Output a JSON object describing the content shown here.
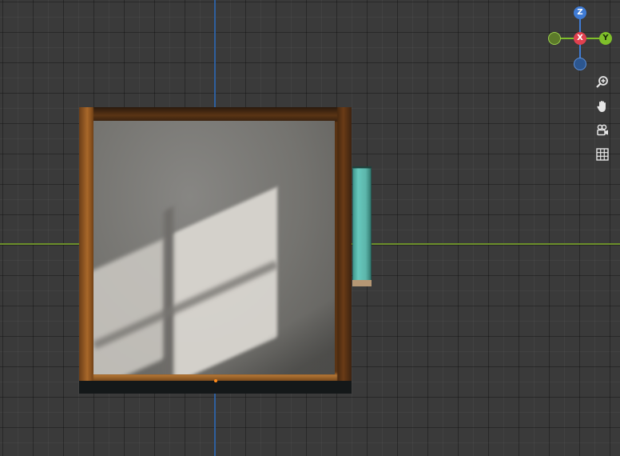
{
  "viewport": {
    "colors": {
      "background": "#3a3a3a",
      "grid_line": "#252525",
      "axis_y": "#6b8f2a",
      "axis_z": "#2e5f9e",
      "origin": "#ff8a1a"
    }
  },
  "gizmo": {
    "z_label": "Z",
    "x_label": "X",
    "y_label": "Y",
    "colors": {
      "x": "#e0404f",
      "y": "#7fbf2a",
      "z": "#3f7bd4"
    }
  },
  "tools": {
    "zoom_icon": "zoom-in-icon",
    "pan_icon": "hand-icon",
    "camera_icon": "camera-icon",
    "grid_icon": "grid-icon"
  }
}
